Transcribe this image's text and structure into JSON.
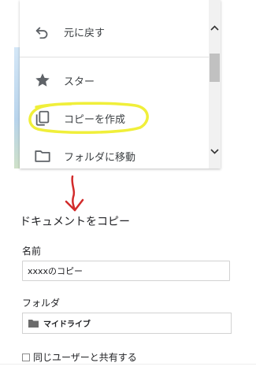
{
  "menu": {
    "items": [
      {
        "label": "元に戻す",
        "icon": "undo-icon"
      },
      {
        "label": "スター",
        "icon": "star-icon"
      },
      {
        "label": "コピーを作成",
        "icon": "copy-icon"
      },
      {
        "label": "フォルダに移動",
        "icon": "folder-icon"
      }
    ]
  },
  "annotations": {
    "highlight_color": "#f0ef3a",
    "arrow_color": "#d22b2b"
  },
  "dialog": {
    "title": "ドキュメントをコピー",
    "name_label": "名前",
    "name_value": "xxxxのコピー",
    "folder_label": "フォルダ",
    "folder_value": "マイドライブ",
    "share_label": "同じユーザーと共有する",
    "share_checked": false
  }
}
